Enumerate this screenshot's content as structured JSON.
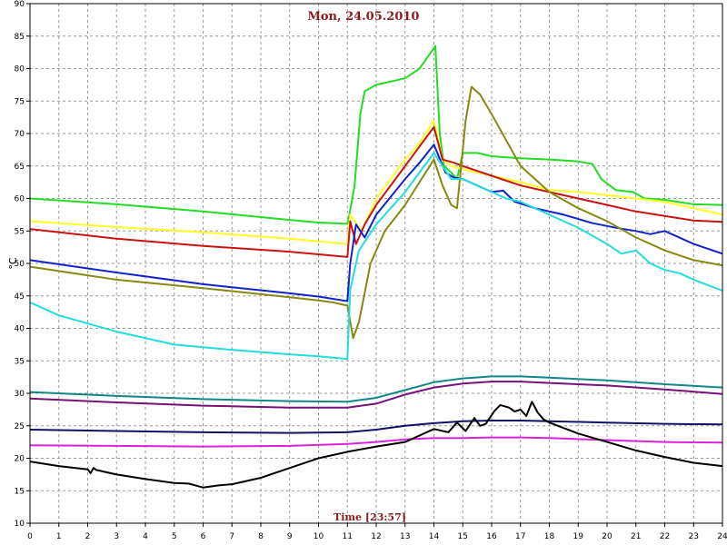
{
  "chart_data": {
    "type": "line",
    "title": "Mon, 24.05.2010",
    "xlabel": "Time [23:57]",
    "ylabel": "°C",
    "xlim": [
      0,
      24
    ],
    "ylim": [
      10,
      90
    ],
    "xticks": [
      0,
      1,
      2,
      3,
      4,
      5,
      6,
      7,
      8,
      9,
      10,
      11,
      12,
      13,
      14,
      15,
      16,
      17,
      18,
      19,
      20,
      21,
      22,
      23,
      24
    ],
    "yticks": [
      10,
      15,
      20,
      25,
      30,
      35,
      40,
      45,
      50,
      55,
      60,
      65,
      70,
      75,
      80,
      85,
      90
    ],
    "grid": true,
    "series": [
      {
        "color": "#22dd22",
        "points": [
          [
            0,
            60
          ],
          [
            3,
            59.1
          ],
          [
            6,
            58
          ],
          [
            9,
            56.7
          ],
          [
            10,
            56.3
          ],
          [
            11,
            56.1
          ],
          [
            11.05,
            57
          ],
          [
            11.25,
            62
          ],
          [
            11.45,
            73
          ],
          [
            11.6,
            76.5
          ],
          [
            12,
            77.5
          ],
          [
            13,
            78.5
          ],
          [
            13.5,
            80
          ],
          [
            13.9,
            82.5
          ],
          [
            14.05,
            83.5
          ],
          [
            14.2,
            70
          ],
          [
            14.35,
            65
          ],
          [
            14.6,
            64
          ],
          [
            14.8,
            63
          ],
          [
            15,
            67
          ],
          [
            15.5,
            67
          ],
          [
            16,
            66.5
          ],
          [
            17,
            66.2
          ],
          [
            18,
            66
          ],
          [
            19,
            65.7
          ],
          [
            19.5,
            65.3
          ],
          [
            19.8,
            63
          ],
          [
            20.3,
            61.3
          ],
          [
            20.9,
            61
          ],
          [
            21.3,
            60
          ],
          [
            22,
            59.8
          ],
          [
            23,
            59.1
          ],
          [
            24,
            59
          ]
        ]
      },
      {
        "color": "#ffff22",
        "points": [
          [
            0,
            56.5
          ],
          [
            3,
            55.6
          ],
          [
            6,
            54.8
          ],
          [
            9,
            53.8
          ],
          [
            10,
            53.4
          ],
          [
            11,
            53
          ],
          [
            11.1,
            57.5
          ],
          [
            11.5,
            55
          ],
          [
            12,
            60
          ],
          [
            13,
            66
          ],
          [
            13.5,
            68.5
          ],
          [
            14,
            72
          ],
          [
            14.3,
            66
          ],
          [
            14.6,
            65
          ],
          [
            15,
            64.5
          ],
          [
            16,
            63.5
          ],
          [
            17,
            62.5
          ],
          [
            18,
            61.3
          ],
          [
            19,
            61
          ],
          [
            20,
            60.5
          ],
          [
            21,
            60
          ],
          [
            22,
            59.5
          ],
          [
            23,
            58.5
          ],
          [
            24,
            57.5
          ]
        ]
      },
      {
        "color": "#cc1111",
        "points": [
          [
            0,
            55.3
          ],
          [
            3,
            53.8
          ],
          [
            6,
            52.7
          ],
          [
            9,
            51.8
          ],
          [
            10,
            51.4
          ],
          [
            11,
            51
          ],
          [
            11.1,
            56.5
          ],
          [
            11.3,
            53
          ],
          [
            11.6,
            56
          ],
          [
            12,
            59
          ],
          [
            13,
            65
          ],
          [
            13.5,
            68
          ],
          [
            14,
            71
          ],
          [
            14.3,
            66
          ],
          [
            14.7,
            65.5
          ],
          [
            15,
            65
          ],
          [
            16,
            63.5
          ],
          [
            17,
            62
          ],
          [
            18,
            61
          ],
          [
            19,
            60
          ],
          [
            20,
            59
          ],
          [
            21,
            58
          ],
          [
            22,
            57.3
          ],
          [
            23,
            56.6
          ],
          [
            24,
            56.4
          ]
        ]
      },
      {
        "color": "#1122cc",
        "points": [
          [
            0,
            50.5
          ],
          [
            3,
            48.6
          ],
          [
            6,
            46.8
          ],
          [
            9,
            45.4
          ],
          [
            10,
            44.9
          ],
          [
            11,
            44.2
          ],
          [
            11.1,
            50
          ],
          [
            11.3,
            56
          ],
          [
            11.6,
            54
          ],
          [
            12,
            57.5
          ],
          [
            13,
            63
          ],
          [
            13.5,
            65.5
          ],
          [
            14,
            68.3
          ],
          [
            14.4,
            64
          ],
          [
            14.7,
            63.2
          ],
          [
            15,
            63
          ],
          [
            15.5,
            62
          ],
          [
            16,
            61
          ],
          [
            16.4,
            61.2
          ],
          [
            16.8,
            59.5
          ],
          [
            17.5,
            58.5
          ],
          [
            18.5,
            57.5
          ],
          [
            19.5,
            56.2
          ],
          [
            20.3,
            55.5
          ],
          [
            21,
            55
          ],
          [
            21.5,
            54.5
          ],
          [
            22,
            55
          ],
          [
            22.5,
            54
          ],
          [
            23,
            53
          ],
          [
            24,
            51.5
          ]
        ]
      },
      {
        "color": "#888811",
        "points": [
          [
            0,
            49.5
          ],
          [
            3,
            47.5
          ],
          [
            6,
            46.2
          ],
          [
            9,
            44.8
          ],
          [
            10,
            44.3
          ],
          [
            10.5,
            44
          ],
          [
            11,
            43.5
          ],
          [
            11.2,
            38.5
          ],
          [
            11.4,
            41
          ],
          [
            11.8,
            50
          ],
          [
            12.3,
            55
          ],
          [
            13,
            59
          ],
          [
            13.5,
            62.5
          ],
          [
            14,
            66
          ],
          [
            14.3,
            62
          ],
          [
            14.6,
            59
          ],
          [
            14.8,
            58.5
          ],
          [
            15.1,
            72
          ],
          [
            15.3,
            77.2
          ],
          [
            15.6,
            76
          ],
          [
            16,
            73
          ],
          [
            17,
            65
          ],
          [
            18,
            61
          ],
          [
            19,
            58.5
          ],
          [
            20,
            56.5
          ],
          [
            21,
            54
          ],
          [
            22,
            52
          ],
          [
            23,
            50.5
          ],
          [
            24,
            49.7
          ]
        ]
      },
      {
        "color": "#22dddd",
        "points": [
          [
            0,
            44
          ],
          [
            1,
            42
          ],
          [
            3,
            39.5
          ],
          [
            5,
            37.5
          ],
          [
            7,
            36.7
          ],
          [
            9,
            36
          ],
          [
            10,
            35.7
          ],
          [
            11,
            35.3
          ],
          [
            11.1,
            46
          ],
          [
            11.4,
            52
          ],
          [
            11.7,
            54
          ],
          [
            12,
            56
          ],
          [
            13,
            61
          ],
          [
            13.5,
            64
          ],
          [
            14,
            67
          ],
          [
            14.3,
            65
          ],
          [
            14.6,
            63
          ],
          [
            15,
            63
          ],
          [
            15.5,
            62
          ],
          [
            16,
            61
          ],
          [
            16.5,
            60
          ],
          [
            17,
            59.5
          ],
          [
            18,
            57.5
          ],
          [
            19,
            55.5
          ],
          [
            20,
            53
          ],
          [
            20.5,
            51.5
          ],
          [
            21,
            52
          ],
          [
            21.5,
            50
          ],
          [
            22,
            49
          ],
          [
            22.5,
            48.5
          ],
          [
            23,
            47.5
          ],
          [
            24,
            45.8
          ]
        ]
      },
      {
        "color": "#118888",
        "points": [
          [
            0,
            30.2
          ],
          [
            3,
            29.6
          ],
          [
            6,
            29.1
          ],
          [
            9,
            28.8
          ],
          [
            11,
            28.7
          ],
          [
            12,
            29.3
          ],
          [
            13,
            30.5
          ],
          [
            14,
            31.7
          ],
          [
            15,
            32.3
          ],
          [
            16,
            32.6
          ],
          [
            17,
            32.6
          ],
          [
            18,
            32.4
          ],
          [
            20,
            32
          ],
          [
            22,
            31.4
          ],
          [
            24,
            30.9
          ]
        ]
      },
      {
        "color": "#771177",
        "points": [
          [
            0,
            29.2
          ],
          [
            3,
            28.6
          ],
          [
            6,
            28.1
          ],
          [
            9,
            27.8
          ],
          [
            11,
            27.8
          ],
          [
            12,
            28.4
          ],
          [
            13,
            29.8
          ],
          [
            14,
            30.9
          ],
          [
            15,
            31.5
          ],
          [
            16,
            31.8
          ],
          [
            17,
            31.8
          ],
          [
            18,
            31.6
          ],
          [
            20,
            31.2
          ],
          [
            22,
            30.6
          ],
          [
            24,
            29.9
          ]
        ]
      },
      {
        "color": "#111166",
        "points": [
          [
            0,
            24.4
          ],
          [
            3,
            24.2
          ],
          [
            6,
            24
          ],
          [
            9,
            23.9
          ],
          [
            11,
            24
          ],
          [
            12,
            24.4
          ],
          [
            13,
            25
          ],
          [
            14,
            25.4
          ],
          [
            15,
            25.7
          ],
          [
            16,
            25.8
          ],
          [
            17,
            25.8
          ],
          [
            18,
            25.7
          ],
          [
            20,
            25.5
          ],
          [
            22,
            25.3
          ],
          [
            24,
            25.2
          ]
        ]
      },
      {
        "color": "#dd22dd",
        "points": [
          [
            0,
            22
          ],
          [
            3,
            21.9
          ],
          [
            6,
            21.8
          ],
          [
            9,
            21.9
          ],
          [
            11,
            22.2
          ],
          [
            12,
            22.5
          ],
          [
            13,
            22.9
          ],
          [
            14,
            23.1
          ],
          [
            15,
            23.1
          ],
          [
            16,
            23.2
          ],
          [
            17,
            23.2
          ],
          [
            18,
            23.1
          ],
          [
            20,
            22.8
          ],
          [
            22,
            22.5
          ],
          [
            24,
            22.4
          ]
        ]
      },
      {
        "color": "#000000",
        "points": [
          [
            0,
            19.5
          ],
          [
            1,
            18.8
          ],
          [
            2,
            18.3
          ],
          [
            2.1,
            17.7
          ],
          [
            2.2,
            18.5
          ],
          [
            2.3,
            18.2
          ],
          [
            3,
            17.5
          ],
          [
            4,
            16.8
          ],
          [
            5,
            16.2
          ],
          [
            5.5,
            16.1
          ],
          [
            6,
            15.5
          ],
          [
            6.5,
            15.8
          ],
          [
            7,
            16
          ],
          [
            8,
            17
          ],
          [
            9,
            18.5
          ],
          [
            10,
            20
          ],
          [
            11,
            21
          ],
          [
            12,
            21.8
          ],
          [
            13,
            22.5
          ],
          [
            14,
            24.5
          ],
          [
            14.5,
            24
          ],
          [
            14.8,
            25.5
          ],
          [
            15.1,
            24.2
          ],
          [
            15.4,
            26.2
          ],
          [
            15.6,
            25
          ],
          [
            15.8,
            25.3
          ],
          [
            16.1,
            27.3
          ],
          [
            16.3,
            28.2
          ],
          [
            16.6,
            27.8
          ],
          [
            16.8,
            27.2
          ],
          [
            17,
            27.5
          ],
          [
            17.2,
            26.5
          ],
          [
            17.4,
            28.7
          ],
          [
            17.6,
            27
          ],
          [
            17.8,
            26
          ],
          [
            18,
            25.5
          ],
          [
            19,
            23.8
          ],
          [
            20,
            22.5
          ],
          [
            21,
            21.2
          ],
          [
            22,
            20.2
          ],
          [
            23,
            19.3
          ],
          [
            24,
            18.8
          ]
        ]
      }
    ]
  }
}
